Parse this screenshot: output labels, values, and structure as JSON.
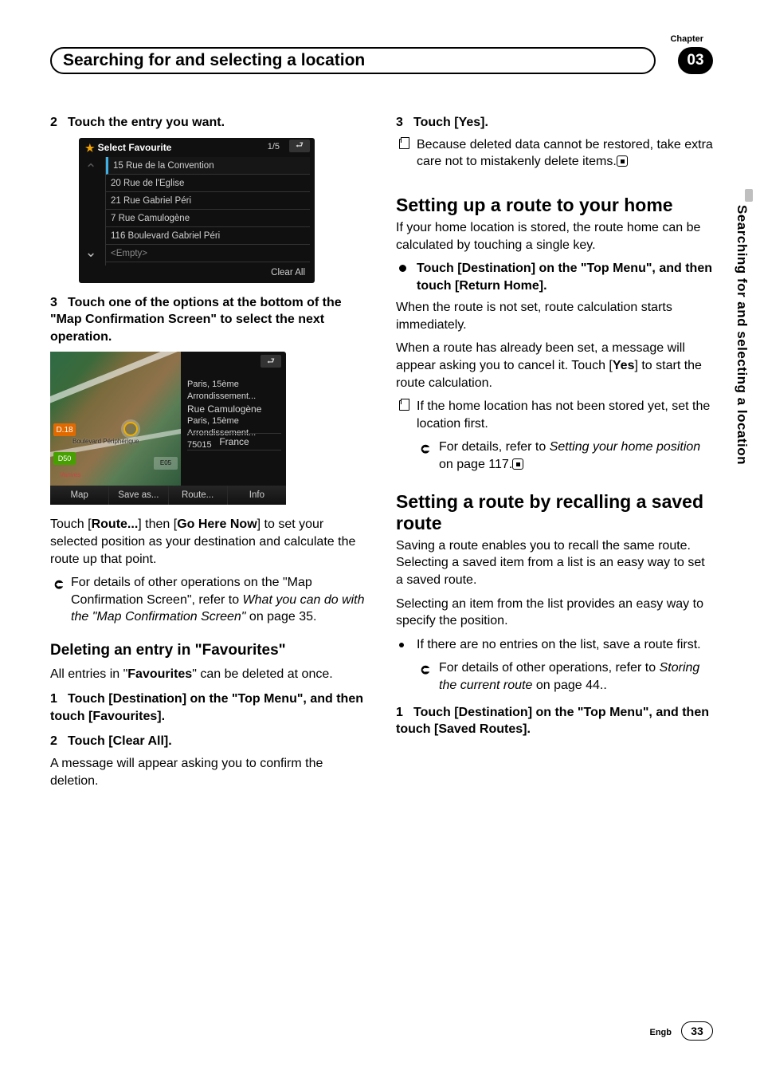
{
  "header": {
    "chapter_label": "Chapter",
    "title": "Searching for and selecting a location",
    "chapter_number": "03",
    "side_tab": "Searching for and selecting a location"
  },
  "left": {
    "step2": "Touch the entry you want.",
    "fav_shot": {
      "title": "Select Favourite",
      "pager": "1/5",
      "rows": [
        "15 Rue de la Convention",
        "20 Rue de l'Eglise",
        "21 Rue Gabriel Péri",
        "7 Rue Camulogène",
        "116 Boulevard Gabriel Péri",
        "<Empty>"
      ],
      "clear_all": "Clear All"
    },
    "step3": "Touch one of the options at the bottom of the \"Map Confirmation Screen\" to select the next operation.",
    "map_shot": {
      "info_line1": "Paris, 15ème Arrondissement...",
      "info_line2": "Rue Camulogène",
      "info_line3": "Paris, 15ème Arrondissement... 75015",
      "country": "France",
      "buttons": [
        "Map",
        "Save as...",
        "Route...",
        "Info"
      ],
      "badge_orange": "D.18",
      "badge_green": "D50",
      "map_text1": "Boulevard Périphérique",
      "map_text2": "Vanves",
      "dist": "E05"
    },
    "para_route_1": "Touch [",
    "para_route_b1": "Route...",
    "para_route_2": "] then [",
    "para_route_b2": "Go Here Now",
    "para_route_3": "] to set your selected position as your destination and calculate the route up that point.",
    "ref1_a": "For details of other operations on the \"Map Confirmation Screen\", refer to ",
    "ref1_it": "What you can do with the \"Map Confirmation Screen\"",
    "ref1_b": " on page 35.",
    "h3_del": "Deleting an entry in \"Favourites\"",
    "del_p1a": "All entries in \"",
    "del_p1b": "Favourites",
    "del_p1c": "\" can be deleted at once.",
    "del_step1": "Touch [Destination] on the \"Top Menu\", and then touch [Favourites].",
    "del_step2": "Touch [Clear All].",
    "del_step2_p": "A message will appear asking you to confirm the deletion."
  },
  "right": {
    "step3": "Touch [Yes].",
    "step3_note": "Because deleted data cannot be restored, take extra care not to mistakenly delete items.",
    "h2_home": "Setting up a route to your home",
    "home_p1": "If your home location is stored, the route home can be calculated by touching a single key.",
    "home_bullet": "Touch [Destination] on the \"Top Menu\", and then touch [Return Home].",
    "home_p2": "When the route is not set, route calculation starts immediately.",
    "home_p3a": "When a route has already been set, a message will appear asking you to cancel it. Touch [",
    "home_p3b": "Yes",
    "home_p3c": "] to start the route calculation.",
    "home_note": "If the home location has not been stored yet, set the location first.",
    "home_ref_a": "For details, refer to ",
    "home_ref_it": "Setting your home position",
    "home_ref_b": " on page 117.",
    "h2_saved": "Setting a route by recalling a saved route",
    "saved_p1": "Saving a route enables you to recall the same route. Selecting a saved item from a list is an easy way to set a saved route.",
    "saved_p2": "Selecting an item from the list provides an easy way to specify the position.",
    "saved_li": "If there are no entries on the list, save a route first.",
    "saved_ref_a": "For details of other operations, refer to ",
    "saved_ref_it": "Storing the current route",
    "saved_ref_b": " on page 44..",
    "saved_step1": "Touch [Destination] on the \"Top Menu\", and then touch [Saved Routes]."
  },
  "footer": {
    "lang": "Engb",
    "page": "33"
  }
}
